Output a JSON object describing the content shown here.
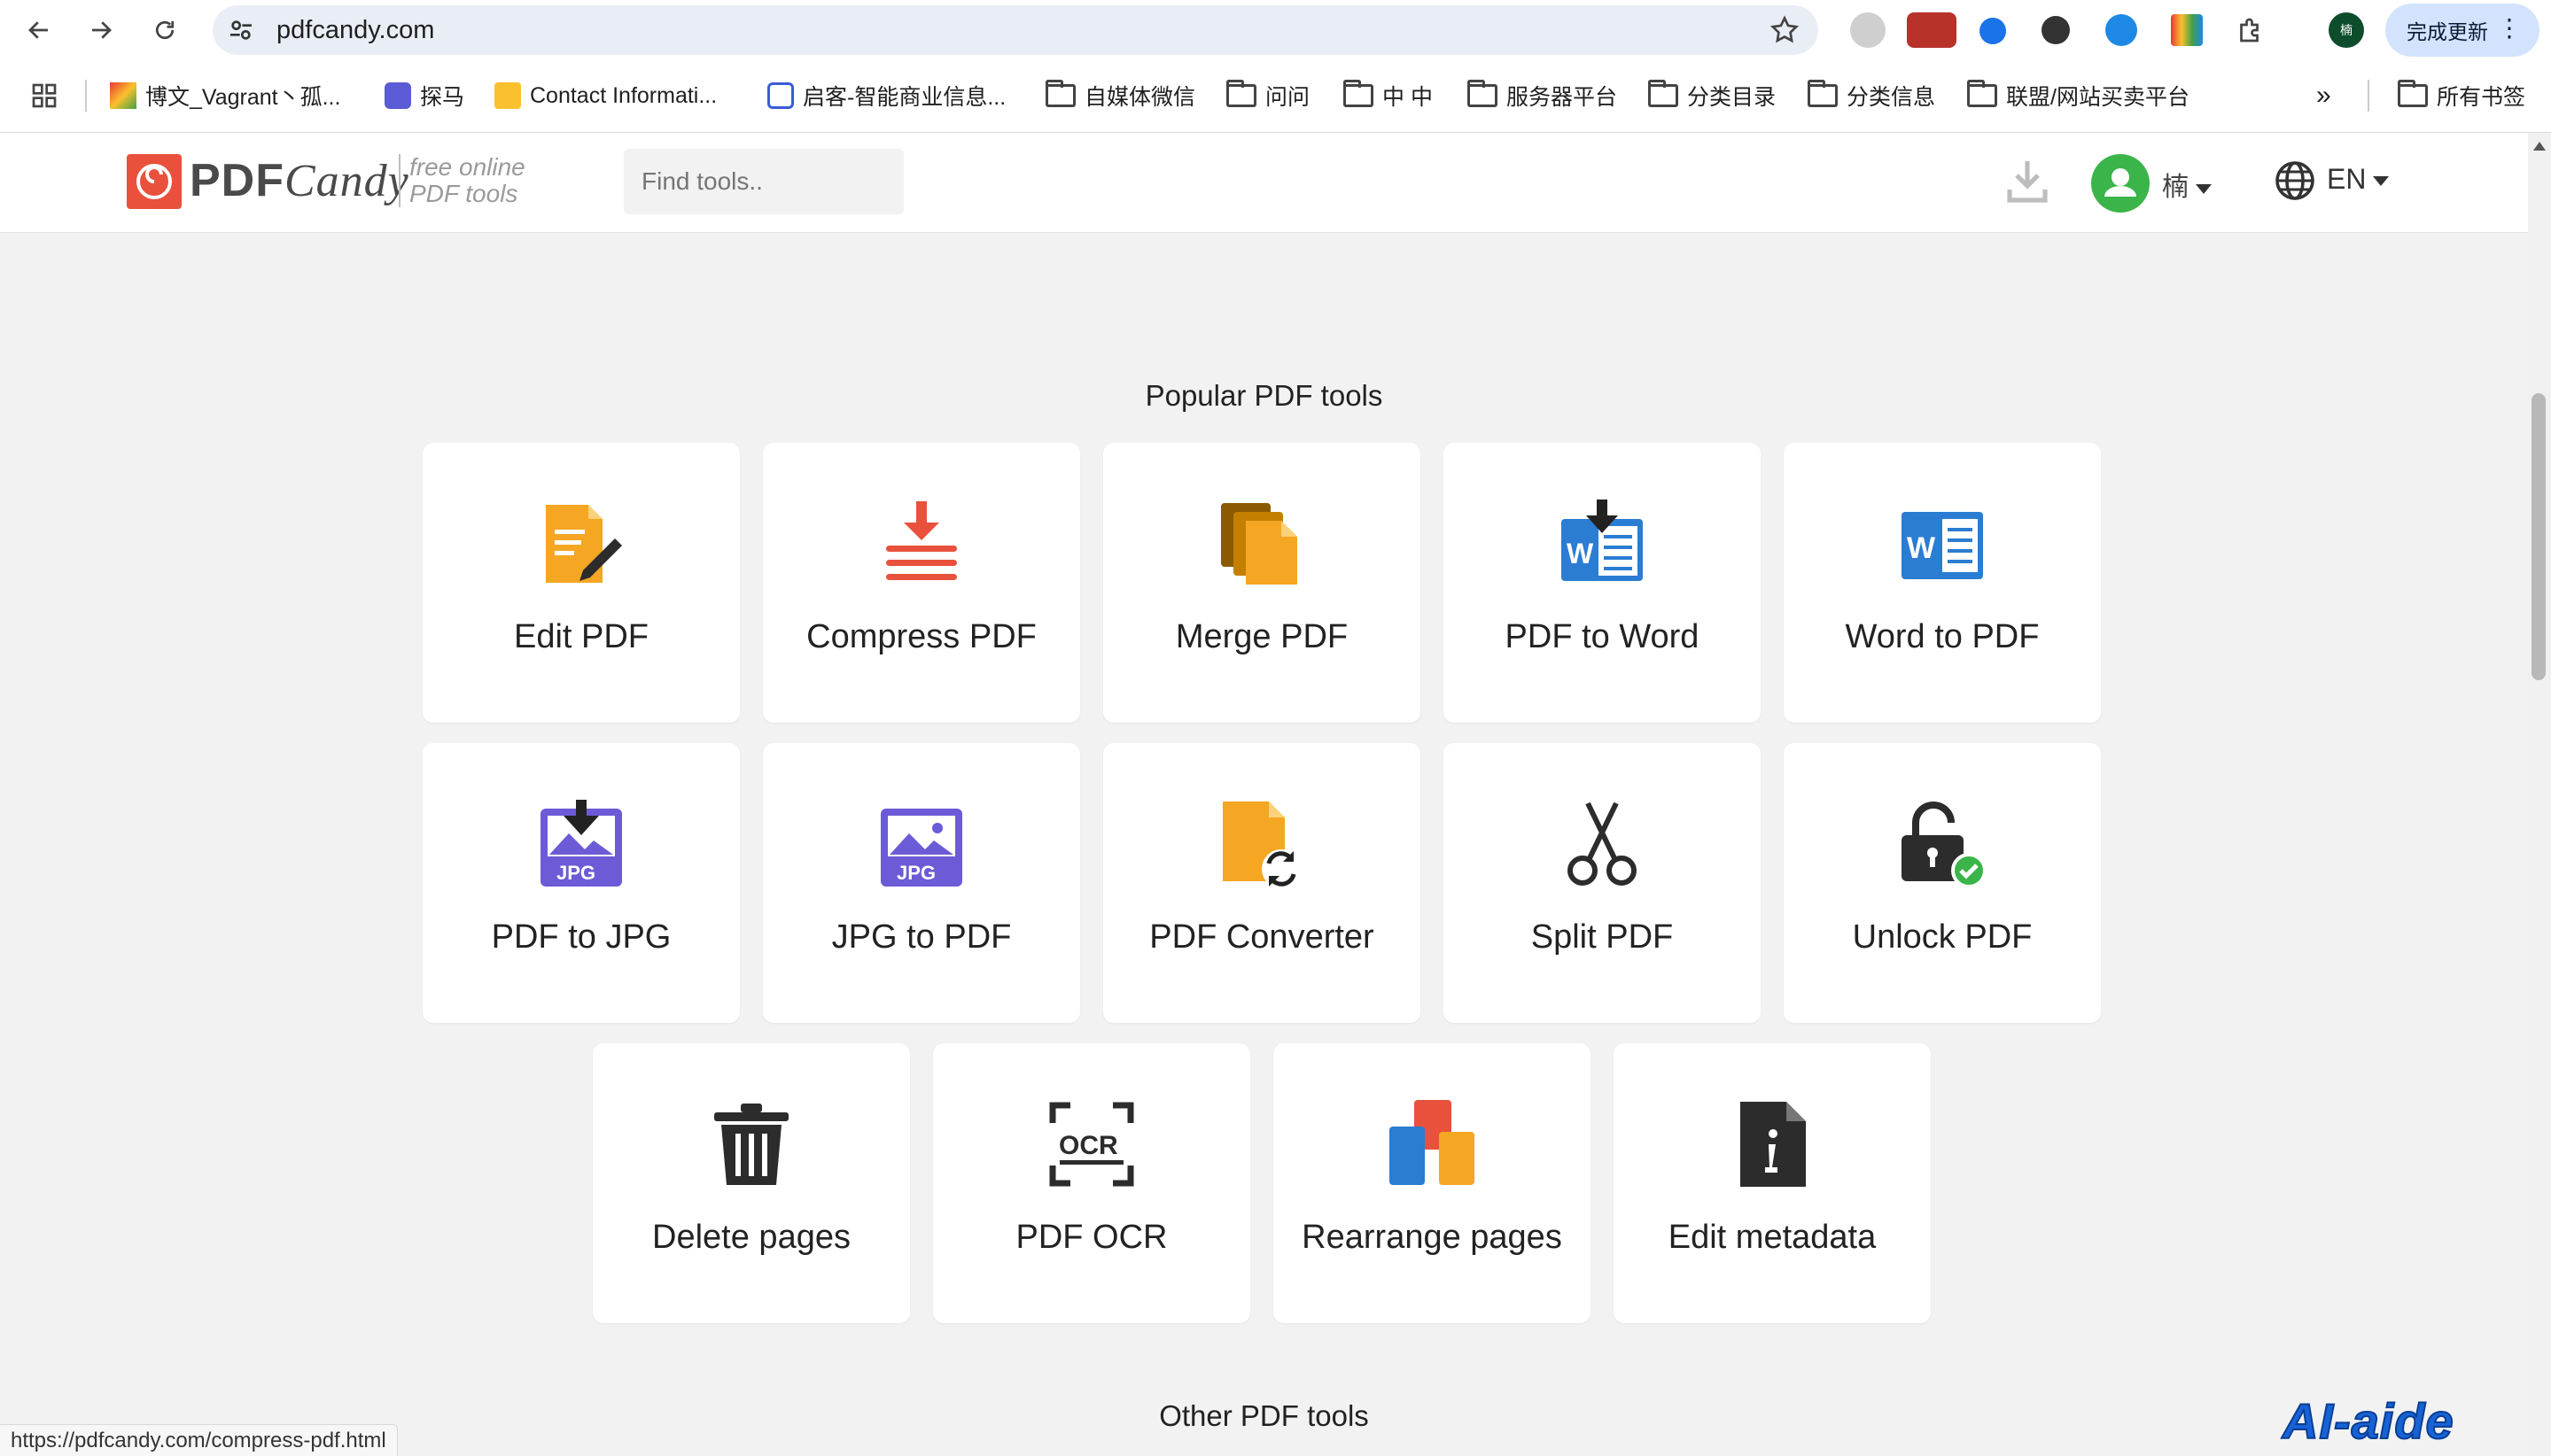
{
  "browser": {
    "url": "pdfcandy.com",
    "update_label": "完成更新",
    "profile_initial": "楠"
  },
  "bookmarks": [
    {
      "label": "博文_Vagrant丶孤...",
      "icon": "colorful-site-icon"
    },
    {
      "label": "探马",
      "icon": "purple-site-icon"
    },
    {
      "label": "Contact Informati...",
      "icon": "yellow-site-icon"
    },
    {
      "label": "启客-智能商业信息...",
      "icon": "blue-site-icon"
    },
    {
      "label": "自媒体微信",
      "icon": "folder-icon"
    },
    {
      "label": "问问",
      "icon": "folder-icon"
    },
    {
      "label": "中 中",
      "icon": "folder-icon"
    },
    {
      "label": "服务器平台",
      "icon": "folder-icon"
    },
    {
      "label": "分类目录",
      "icon": "folder-icon"
    },
    {
      "label": "分类信息",
      "icon": "folder-icon"
    },
    {
      "label": "联盟/网站买卖平台",
      "icon": "folder-icon"
    }
  ],
  "bookmarks_more": "»",
  "bookmarks_all": "所有书签",
  "header": {
    "logo_pdf": "PDF",
    "logo_candy": "Candy",
    "tagline_line1": "free online",
    "tagline_line2": "PDF tools",
    "search_placeholder": "Find tools..",
    "user_name": "楠",
    "language": "EN"
  },
  "popular": {
    "title": "Popular PDF tools",
    "tools": [
      {
        "label": "Edit PDF",
        "icon": "edit-pdf-icon"
      },
      {
        "label": "Compress PDF",
        "icon": "compress-pdf-icon"
      },
      {
        "label": "Merge PDF",
        "icon": "merge-pdf-icon"
      },
      {
        "label": "PDF to Word",
        "icon": "pdf-to-word-icon"
      },
      {
        "label": "Word to PDF",
        "icon": "word-to-pdf-icon"
      },
      {
        "label": "PDF to JPG",
        "icon": "pdf-to-jpg-icon"
      },
      {
        "label": "JPG to PDF",
        "icon": "jpg-to-pdf-icon"
      },
      {
        "label": "PDF Converter",
        "icon": "pdf-converter-icon"
      },
      {
        "label": "Split PDF",
        "icon": "scissors-icon"
      },
      {
        "label": "Unlock PDF",
        "icon": "unlock-icon"
      },
      {
        "label": "Delete pages",
        "icon": "trash-icon"
      },
      {
        "label": "PDF OCR",
        "icon": "ocr-icon"
      },
      {
        "label": "Rearrange pages",
        "icon": "rearrange-icon"
      },
      {
        "label": "Edit metadata",
        "icon": "metadata-icon"
      }
    ]
  },
  "other": {
    "title": "Other PDF tools"
  },
  "status_bar": "https://pdfcandy.com/compress-pdf.html",
  "watermark": "AI-aide",
  "colors": {
    "orange": "#f5a623",
    "red": "#e9513c",
    "word_blue": "#2b7cd3",
    "purple": "#6b5bd6",
    "dark": "#2c2c2c",
    "green": "#3bb54a"
  }
}
